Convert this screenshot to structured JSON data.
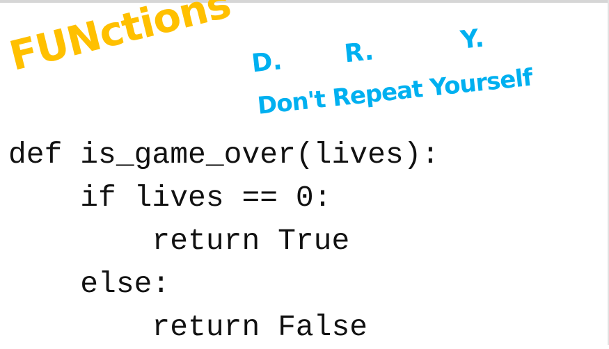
{
  "slide": {
    "title": "FUNctions",
    "dry": {
      "letters": [
        "D.",
        "R.",
        "Y."
      ],
      "expansion": "Don't Repeat Yourself"
    },
    "code_lines": [
      "def is_game_over(lives):",
      "    if lives == 0:",
      "        return True",
      "    else:",
      "        return False"
    ]
  },
  "colors": {
    "title": "#ffc000",
    "dry": "#00b0f0",
    "code": "#111111",
    "background": "#ffffff"
  }
}
